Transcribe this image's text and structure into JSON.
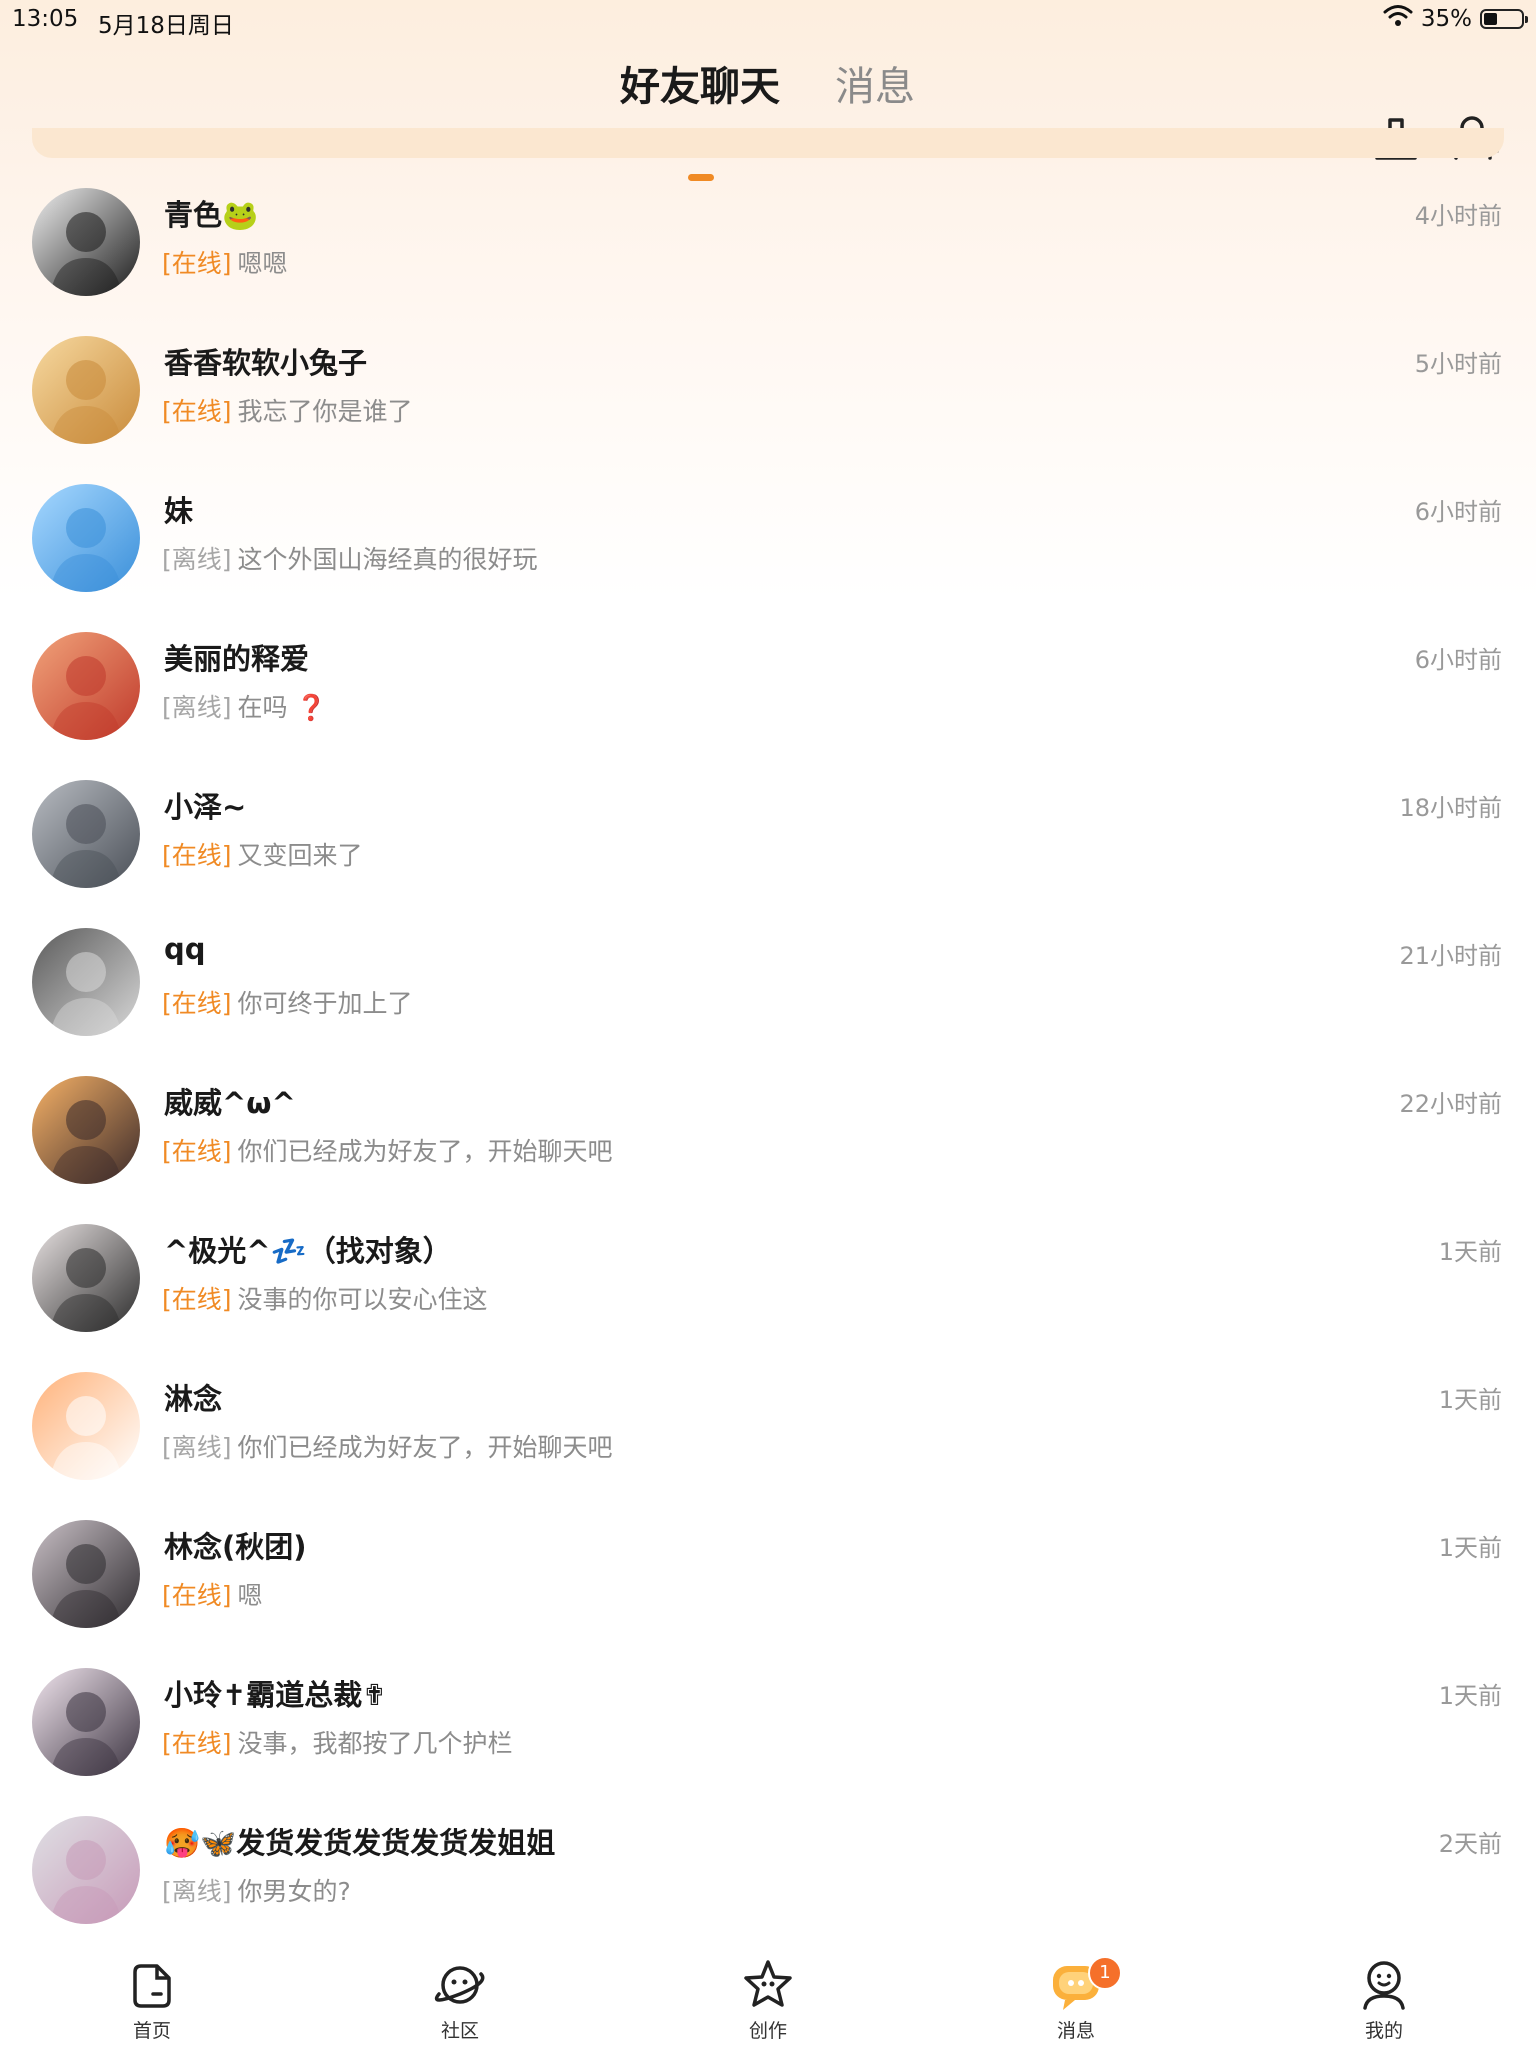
{
  "status_bar": {
    "time": "13:05",
    "date": "5月18日周日",
    "battery": "35%",
    "battery_level": 0.35
  },
  "header": {
    "tab_friends": "好友聊天",
    "tab_messages": "消息",
    "accent_color": "#f08a24"
  },
  "chats": [
    {
      "name": "青色🐸",
      "status": "[在线]",
      "online": true,
      "message": "嗯嗯",
      "time": "4小时前"
    },
    {
      "name": "香香软软小兔子",
      "status": "[在线]",
      "online": true,
      "message": "我忘了你是谁了",
      "time": "5小时前"
    },
    {
      "name": "妹",
      "status": "[离线]",
      "online": false,
      "message": "这个外国山海经真的很好玩",
      "time": "6小时前"
    },
    {
      "name": "美丽的释爱",
      "status": "[离线]",
      "online": false,
      "message": "在吗 ❓",
      "time": "6小时前"
    },
    {
      "name": "小泽~",
      "status": "[在线]",
      "online": true,
      "message": "又变回来了",
      "time": "18小时前"
    },
    {
      "name": "qq",
      "status": "[在线]",
      "online": true,
      "message": "你可终于加上了",
      "time": "21小时前"
    },
    {
      "name": "威威^ω^",
      "status": "[在线]",
      "online": true,
      "message": "你们已经成为好友了，开始聊天吧",
      "time": "22小时前"
    },
    {
      "name": "^极光^💤（找对象）",
      "status": "[在线]",
      "online": true,
      "message": "没事的你可以安心住这",
      "time": "1天前"
    },
    {
      "name": "淋念",
      "status": "[离线]",
      "online": false,
      "message": "你们已经成为好友了，开始聊天吧",
      "time": "1天前"
    },
    {
      "name": "林念(秋团)",
      "status": "[在线]",
      "online": true,
      "message": "嗯",
      "time": "1天前"
    },
    {
      "name": "小玲✝霸道总裁✟",
      "status": "[在线]",
      "online": true,
      "message": "没事，我都按了几个护栏",
      "time": "1天前"
    },
    {
      "name": "🥵🦋发货发货发货发货发姐姐",
      "status": "[离线]",
      "online": false,
      "message": "你男女的?",
      "time": "2天前"
    }
  ],
  "tabbar": {
    "home": "首页",
    "community": "社区",
    "create": "创作",
    "messages": "消息",
    "messages_badge": "1",
    "me": "我的"
  }
}
